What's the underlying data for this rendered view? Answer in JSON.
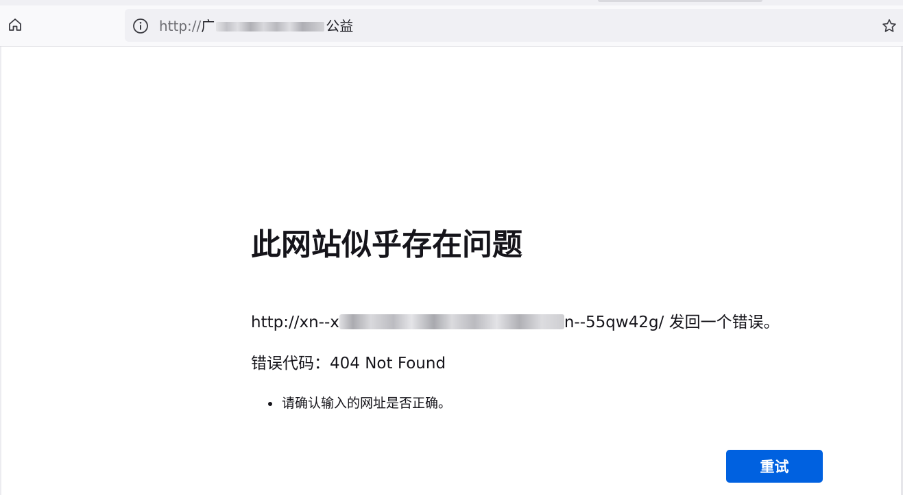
{
  "toolbar": {
    "home_icon": "home-icon",
    "info_icon": "info-icon",
    "bookmark_icon": "star-icon"
  },
  "urlbar": {
    "scheme": "http://",
    "host_start": "广",
    "host_end": "公益"
  },
  "error_page": {
    "title": "此网站似乎存在问题",
    "url_start": "http://xn--x",
    "url_end": "n--55qw42g/ 发回一个错误。",
    "error_code": "错误代码：404 Not Found",
    "suggestions": [
      "请确认输入的网址是否正确。"
    ],
    "retry_label": "重试"
  },
  "colors": {
    "accent": "#0061e0",
    "text": "#15141a",
    "toolbar_bg": "#f9f9fb",
    "urlbar_bg": "#f0f0f4"
  }
}
